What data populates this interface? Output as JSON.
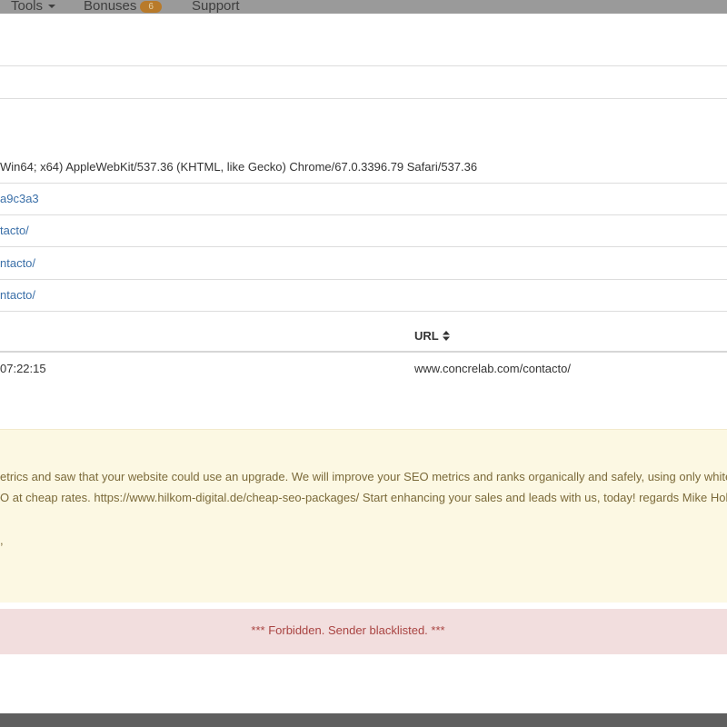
{
  "nav": {
    "tools_label": "Tools",
    "bonuses_label": "Bonuses",
    "bonuses_count": "6",
    "support_label": "Support"
  },
  "details": {
    "user_agent": "Win64; x64) AppleWebKit/537.36 (KHTML, like Gecko) Chrome/67.0.3396.79 Safari/537.36",
    "hash": "a9c3a3",
    "link_1": "tacto/",
    "link_2": "ntacto/",
    "link_3": "ntacto/"
  },
  "visits_table": {
    "url_header": "URL",
    "row_time": "07:22:15",
    "row_url": "www.concrelab.com/contacto/"
  },
  "message": {
    "line_1": "etrics and saw that your website could use an upgrade. We will improve your SEO metrics and ranks organically and safely, using only whitehat",
    "line_2": "O at cheap rates. https://www.hilkom-digital.de/cheap-seo-packages/ Start enhancing your sales and leads with us, today! regards Mike Holiday",
    "line_3": ","
  },
  "status": {
    "error_text": "*** Forbidden. Sender blacklisted. ***"
  }
}
